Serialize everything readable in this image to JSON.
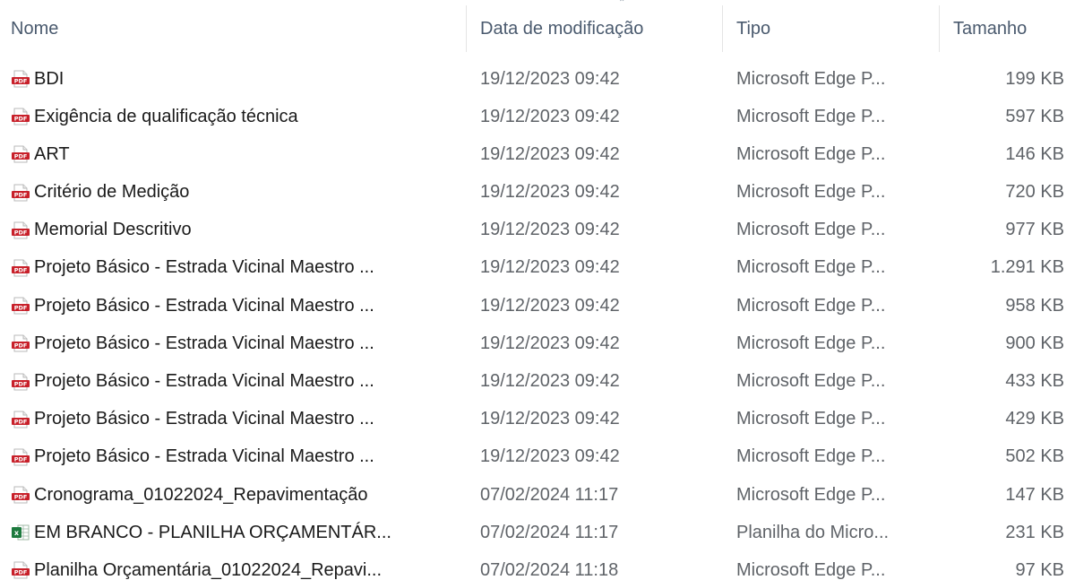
{
  "columns": {
    "name": "Nome",
    "date": "Data de modificação",
    "type": "Tipo",
    "size": "Tamanho"
  },
  "files": [
    {
      "name": "BDI",
      "date": "19/12/2023 09:42",
      "type": "Microsoft Edge P...",
      "size": "199 KB",
      "icon": "pdf-icon"
    },
    {
      "name": "Exigência de qualificação técnica",
      "date": "19/12/2023 09:42",
      "type": "Microsoft Edge P...",
      "size": "597 KB",
      "icon": "pdf-icon"
    },
    {
      "name": "ART",
      "date": "19/12/2023 09:42",
      "type": "Microsoft Edge P...",
      "size": "146 KB",
      "icon": "pdf-icon"
    },
    {
      "name": "Critério de Medição",
      "date": "19/12/2023 09:42",
      "type": "Microsoft Edge P...",
      "size": "720 KB",
      "icon": "pdf-icon"
    },
    {
      "name": "Memorial Descritivo",
      "date": "19/12/2023 09:42",
      "type": "Microsoft Edge P...",
      "size": "977 KB",
      "icon": "pdf-icon"
    },
    {
      "name": "Projeto Básico - Estrada Vicinal Maestro ...",
      "date": "19/12/2023 09:42",
      "type": "Microsoft Edge P...",
      "size": "1.291 KB",
      "icon": "pdf-icon"
    },
    {
      "name": "Projeto Básico - Estrada Vicinal Maestro ...",
      "date": "19/12/2023 09:42",
      "type": "Microsoft Edge P...",
      "size": "958 KB",
      "icon": "pdf-icon"
    },
    {
      "name": "Projeto Básico - Estrada Vicinal Maestro ...",
      "date": "19/12/2023 09:42",
      "type": "Microsoft Edge P...",
      "size": "900 KB",
      "icon": "pdf-icon"
    },
    {
      "name": "Projeto Básico - Estrada Vicinal Maestro ...",
      "date": "19/12/2023 09:42",
      "type": "Microsoft Edge P...",
      "size": "433 KB",
      "icon": "pdf-icon"
    },
    {
      "name": "Projeto Básico - Estrada Vicinal Maestro ...",
      "date": "19/12/2023 09:42",
      "type": "Microsoft Edge P...",
      "size": "429 KB",
      "icon": "pdf-icon"
    },
    {
      "name": "Projeto Básico - Estrada Vicinal Maestro ...",
      "date": "19/12/2023 09:42",
      "type": "Microsoft Edge P...",
      "size": "502 KB",
      "icon": "pdf-icon"
    },
    {
      "name": "Cronograma_01022024_Repavimentação",
      "date": "07/02/2024 11:17",
      "type": "Microsoft Edge P...",
      "size": "147 KB",
      "icon": "pdf-icon"
    },
    {
      "name": "EM BRANCO - PLANILHA ORÇAMENTÁR...",
      "date": "07/02/2024 11:17",
      "type": "Planilha do Micro...",
      "size": "231 KB",
      "icon": "excel-icon"
    },
    {
      "name": "Planilha Orçamentária_01022024_Repavi...",
      "date": "07/02/2024 11:18",
      "type": "Microsoft Edge P...",
      "size": "97 KB",
      "icon": "pdf-icon"
    }
  ],
  "colors": {
    "pdf": "#c8202a",
    "excel": "#1d7a3e",
    "header_text": "#4a5a6e",
    "secondary_text": "#5f6368"
  }
}
